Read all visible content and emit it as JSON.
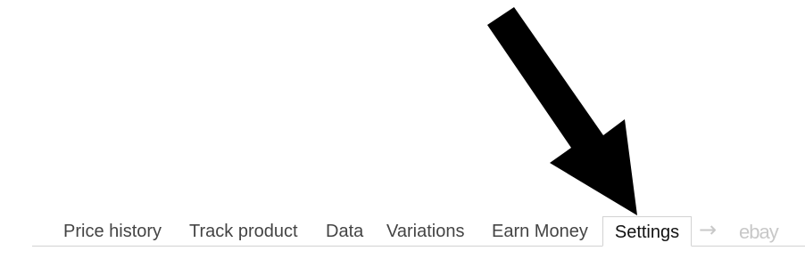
{
  "tabs": [
    {
      "label": "Price history",
      "active": false
    },
    {
      "label": "Track product",
      "active": false
    },
    {
      "label": "Data",
      "active": false
    },
    {
      "label": "Variations",
      "active": false
    },
    {
      "label": "Earn Money",
      "active": false
    },
    {
      "label": "Settings",
      "active": true
    }
  ],
  "arrow_glyph": "→",
  "marketplace_link": "ebay",
  "colors": {
    "tab_text": "#444444",
    "active_tab_text": "#111111",
    "border": "#d2d2d2",
    "muted": "#c8c8c8",
    "annotation_arrow": "#000000"
  },
  "icons": {
    "annotation": "callout-arrow-icon",
    "separator": "right-arrow-icon"
  }
}
